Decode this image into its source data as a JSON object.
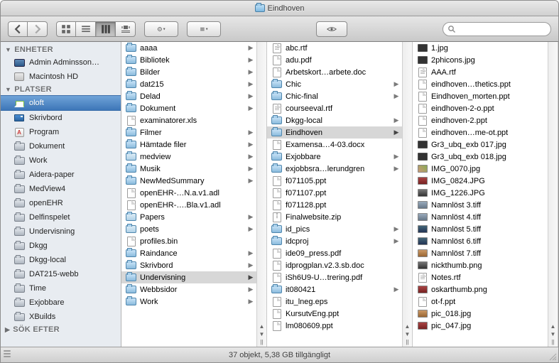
{
  "window_title": "Eindhoven",
  "search": {
    "placeholder": ""
  },
  "sidebar": {
    "sections": [
      {
        "label": "ENHETER",
        "expanded": true,
        "items": [
          {
            "label": "Admin Adminsson…",
            "icon": "monitor"
          },
          {
            "label": "Macintosh HD",
            "icon": "disk"
          }
        ]
      },
      {
        "label": "PLATSER",
        "expanded": true,
        "items": [
          {
            "label": "oloft",
            "icon": "house",
            "selected": true
          },
          {
            "label": "Skrivbord",
            "icon": "desk"
          },
          {
            "label": "Program",
            "icon": "app"
          },
          {
            "label": "Dokument",
            "icon": "sfolder"
          },
          {
            "label": "Work",
            "icon": "sfolder"
          },
          {
            "label": "Aidera-paper",
            "icon": "sfolder"
          },
          {
            "label": "MedView4",
            "icon": "sfolder"
          },
          {
            "label": "openEHR",
            "icon": "sfolder"
          },
          {
            "label": "Delfinspelet",
            "icon": "sfolder"
          },
          {
            "label": "Undervisning",
            "icon": "sfolder"
          },
          {
            "label": "Dkgg",
            "icon": "sfolder"
          },
          {
            "label": "Dkgg-local",
            "icon": "sfolder"
          },
          {
            "label": "DAT215-webb",
            "icon": "sfolder"
          },
          {
            "label": "Time",
            "icon": "sfolder"
          },
          {
            "label": "Exjobbare",
            "icon": "sfolder"
          },
          {
            "label": "XBuilds",
            "icon": "sfolder"
          }
        ]
      },
      {
        "label": "SÖK EFTER",
        "expanded": false,
        "items": []
      }
    ]
  },
  "columns": [
    [
      {
        "name": "aaaa",
        "icon": "folder",
        "arrow": true
      },
      {
        "name": "Bibliotek",
        "icon": "folder",
        "arrow": true
      },
      {
        "name": "Bilder",
        "icon": "folder",
        "arrow": true
      },
      {
        "name": "dat215",
        "icon": "folder",
        "arrow": true
      },
      {
        "name": "Delad",
        "icon": "folder",
        "arrow": true
      },
      {
        "name": "Dokument",
        "icon": "folder",
        "arrow": true
      },
      {
        "name": "examinatorer.xls",
        "icon": "doc"
      },
      {
        "name": "Filmer",
        "icon": "folder",
        "arrow": true
      },
      {
        "name": "Hämtade filer",
        "icon": "folder",
        "arrow": true
      },
      {
        "name": "medview",
        "icon": "folder-t",
        "arrow": true
      },
      {
        "name": "Musik",
        "icon": "folder",
        "arrow": true
      },
      {
        "name": "NewMedSummary",
        "icon": "folder",
        "arrow": true
      },
      {
        "name": "openEHR-…N.a.v1.adl",
        "icon": "doc"
      },
      {
        "name": "openEHR-….Bla.v1.adl",
        "icon": "doc"
      },
      {
        "name": "Papers",
        "icon": "folder-t",
        "arrow": true
      },
      {
        "name": "poets",
        "icon": "folder-t",
        "arrow": true
      },
      {
        "name": "profiles.bin",
        "icon": "doc"
      },
      {
        "name": "Raindance",
        "icon": "folder",
        "arrow": true
      },
      {
        "name": "Skrivbord",
        "icon": "folder",
        "arrow": true
      },
      {
        "name": "Undervisning",
        "icon": "folder",
        "arrow": true,
        "selected": true
      },
      {
        "name": "Webbsidor",
        "icon": "folder",
        "arrow": true
      },
      {
        "name": "Work",
        "icon": "folder",
        "arrow": true
      }
    ],
    [
      {
        "name": "abc.rtf",
        "icon": "rtf"
      },
      {
        "name": "adu.pdf",
        "icon": "doc"
      },
      {
        "name": "Arbetskort…arbete.doc",
        "icon": "doc"
      },
      {
        "name": "Chic",
        "icon": "folder",
        "arrow": true
      },
      {
        "name": "Chic-final",
        "icon": "folder",
        "arrow": true
      },
      {
        "name": "courseeval.rtf",
        "icon": "rtf"
      },
      {
        "name": "Dkgg-local",
        "icon": "folder",
        "arrow": true
      },
      {
        "name": "Eindhoven",
        "icon": "folder",
        "arrow": true,
        "selected": true
      },
      {
        "name": "Examensa…4-03.docx",
        "icon": "doc"
      },
      {
        "name": "Exjobbare",
        "icon": "folder",
        "arrow": true
      },
      {
        "name": "exjobbsra…lerundgren",
        "icon": "folder",
        "arrow": true
      },
      {
        "name": "f071105.ppt",
        "icon": "doc"
      },
      {
        "name": "f071107.ppt",
        "icon": "doc"
      },
      {
        "name": "f071128.ppt",
        "icon": "doc"
      },
      {
        "name": "Finalwebsite.zip",
        "icon": "zip"
      },
      {
        "name": "id_pics",
        "icon": "folder",
        "arrow": true
      },
      {
        "name": "idcproj",
        "icon": "folder",
        "arrow": true
      },
      {
        "name": "ide09_press.pdf",
        "icon": "doc"
      },
      {
        "name": "idprogplan.v2.3.sb.doc",
        "icon": "doc"
      },
      {
        "name": "iSh6U9-U…trering.pdf",
        "icon": "doc"
      },
      {
        "name": "it080421",
        "icon": "folder",
        "arrow": true
      },
      {
        "name": "itu_lneg.eps",
        "icon": "doc"
      },
      {
        "name": "KursutvEng.ppt",
        "icon": "doc"
      },
      {
        "name": "lm080609.ppt",
        "icon": "doc"
      }
    ],
    [
      {
        "name": "1.jpg",
        "icon": "img-dark"
      },
      {
        "name": "2phicons.jpg",
        "icon": "img-dark"
      },
      {
        "name": "AAA.rtf",
        "icon": "rtf"
      },
      {
        "name": "eindhoven…thetics.ppt",
        "icon": "doc"
      },
      {
        "name": "Eindhoven_morten.ppt",
        "icon": "doc"
      },
      {
        "name": "eindhoven-2-o.ppt",
        "icon": "doc"
      },
      {
        "name": "eindhoven-2.ppt",
        "icon": "doc"
      },
      {
        "name": "eindhoven…me-ot.ppt",
        "icon": "doc"
      },
      {
        "name": "Gr3_ubq_exb 017.jpg",
        "icon": "img-dark"
      },
      {
        "name": "Gr3_ubq_exb 018.jpg",
        "icon": "img-dark"
      },
      {
        "name": "IMG_0070.jpg",
        "icon": "thumb t1"
      },
      {
        "name": "IMG_0824.JPG",
        "icon": "thumb t2"
      },
      {
        "name": "IMG_1226.JPG",
        "icon": "thumb t4"
      },
      {
        "name": "Namnlöst 3.tiff",
        "icon": "thumb t6"
      },
      {
        "name": "Namnlöst 4.tiff",
        "icon": "thumb t6"
      },
      {
        "name": "Namnlöst 5.tiff",
        "icon": "thumb t3"
      },
      {
        "name": "Namnlöst 6.tiff",
        "icon": "thumb t3"
      },
      {
        "name": "Namnlöst 7.tiff",
        "icon": "thumb t5"
      },
      {
        "name": "nickthumb.png",
        "icon": "thumb t4"
      },
      {
        "name": "Notes.rtf",
        "icon": "rtf"
      },
      {
        "name": "oskarthumb.png",
        "icon": "thumb t2"
      },
      {
        "name": "ot-f.ppt",
        "icon": "doc"
      },
      {
        "name": "pic_018.jpg",
        "icon": "thumb t5"
      },
      {
        "name": "pic_047.jpg",
        "icon": "thumb t2"
      }
    ]
  ],
  "status": "37 objekt, 5,38 GB tillgängligt"
}
